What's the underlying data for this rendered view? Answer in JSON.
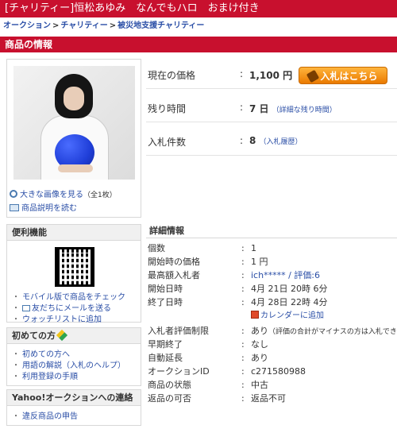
{
  "title": "[チャリティー]恒松あゆみ　なんでもハロ　おまけ付き",
  "breadcrumb": [
    "オークション",
    "チャリティー",
    "被災地支援チャリティー"
  ],
  "breadcrumb_sep": ">",
  "section_title": "商品の情報",
  "photo_links": {
    "large_image": "大きな画像を見る",
    "large_image_count": "（全1枚）",
    "description": "商品説明を読む"
  },
  "price": {
    "label": "現在の価格",
    "colon": ":",
    "value": "1,100 円"
  },
  "bid_button": "入札はこちら",
  "time_left": {
    "label": "残り時間",
    "colon": ":",
    "value": "7 日",
    "detail": "（詳細な残り時間）"
  },
  "bid_count": {
    "label": "入札件数",
    "colon": ":",
    "value": "8",
    "detail": "（入札履歴）"
  },
  "convenience": {
    "title": "便利機能",
    "items": [
      "モバイル版で商品をチェック",
      "友だちにメールを送る",
      "ウォッチリストに追加"
    ]
  },
  "beginner": {
    "title": "初めての方",
    "items": [
      "初めての方へ",
      "用語の解説（入札のヘルプ）",
      "利用登録の手順"
    ]
  },
  "contact": {
    "title": "Yahoo!オークションへの連絡",
    "items": [
      "違反商品の申告"
    ]
  },
  "details": {
    "title": "詳細情報",
    "rows": [
      {
        "k": "個数",
        "v": "1"
      },
      {
        "k": "開始時の価格",
        "v": "1 円"
      },
      {
        "k": "最高額入札者",
        "v": "ich***** / 評価:6"
      },
      {
        "k": "開始日時",
        "v": "4月 21日 20時 6分"
      },
      {
        "k": "終了日時",
        "v": "4月 28日 22時 4分"
      },
      {
        "k": "",
        "v": "カレンダーに追加"
      },
      {
        "k": "入札者評価制限",
        "v": "あり",
        "note": "（評価の合計がマイナスの方は入札でき"
      },
      {
        "k": "早期終了",
        "v": "なし"
      },
      {
        "k": "自動延長",
        "v": "あり"
      },
      {
        "k": "オークションID",
        "v": "c271580988"
      },
      {
        "k": "商品の状態",
        "v": "中古"
      },
      {
        "k": "返品の可否",
        "v": "返品不可"
      }
    ]
  },
  "colon": ":",
  "colors": {
    "brand_red": "#c8102e",
    "link_blue": "#2a4ea6",
    "bid_orange": "#ea7a00"
  },
  "icons": [
    "magnifier-icon",
    "book-icon",
    "mail-icon",
    "beginner-leaf-icon",
    "calendar-icon",
    "hammer-icon",
    "qr-code"
  ]
}
